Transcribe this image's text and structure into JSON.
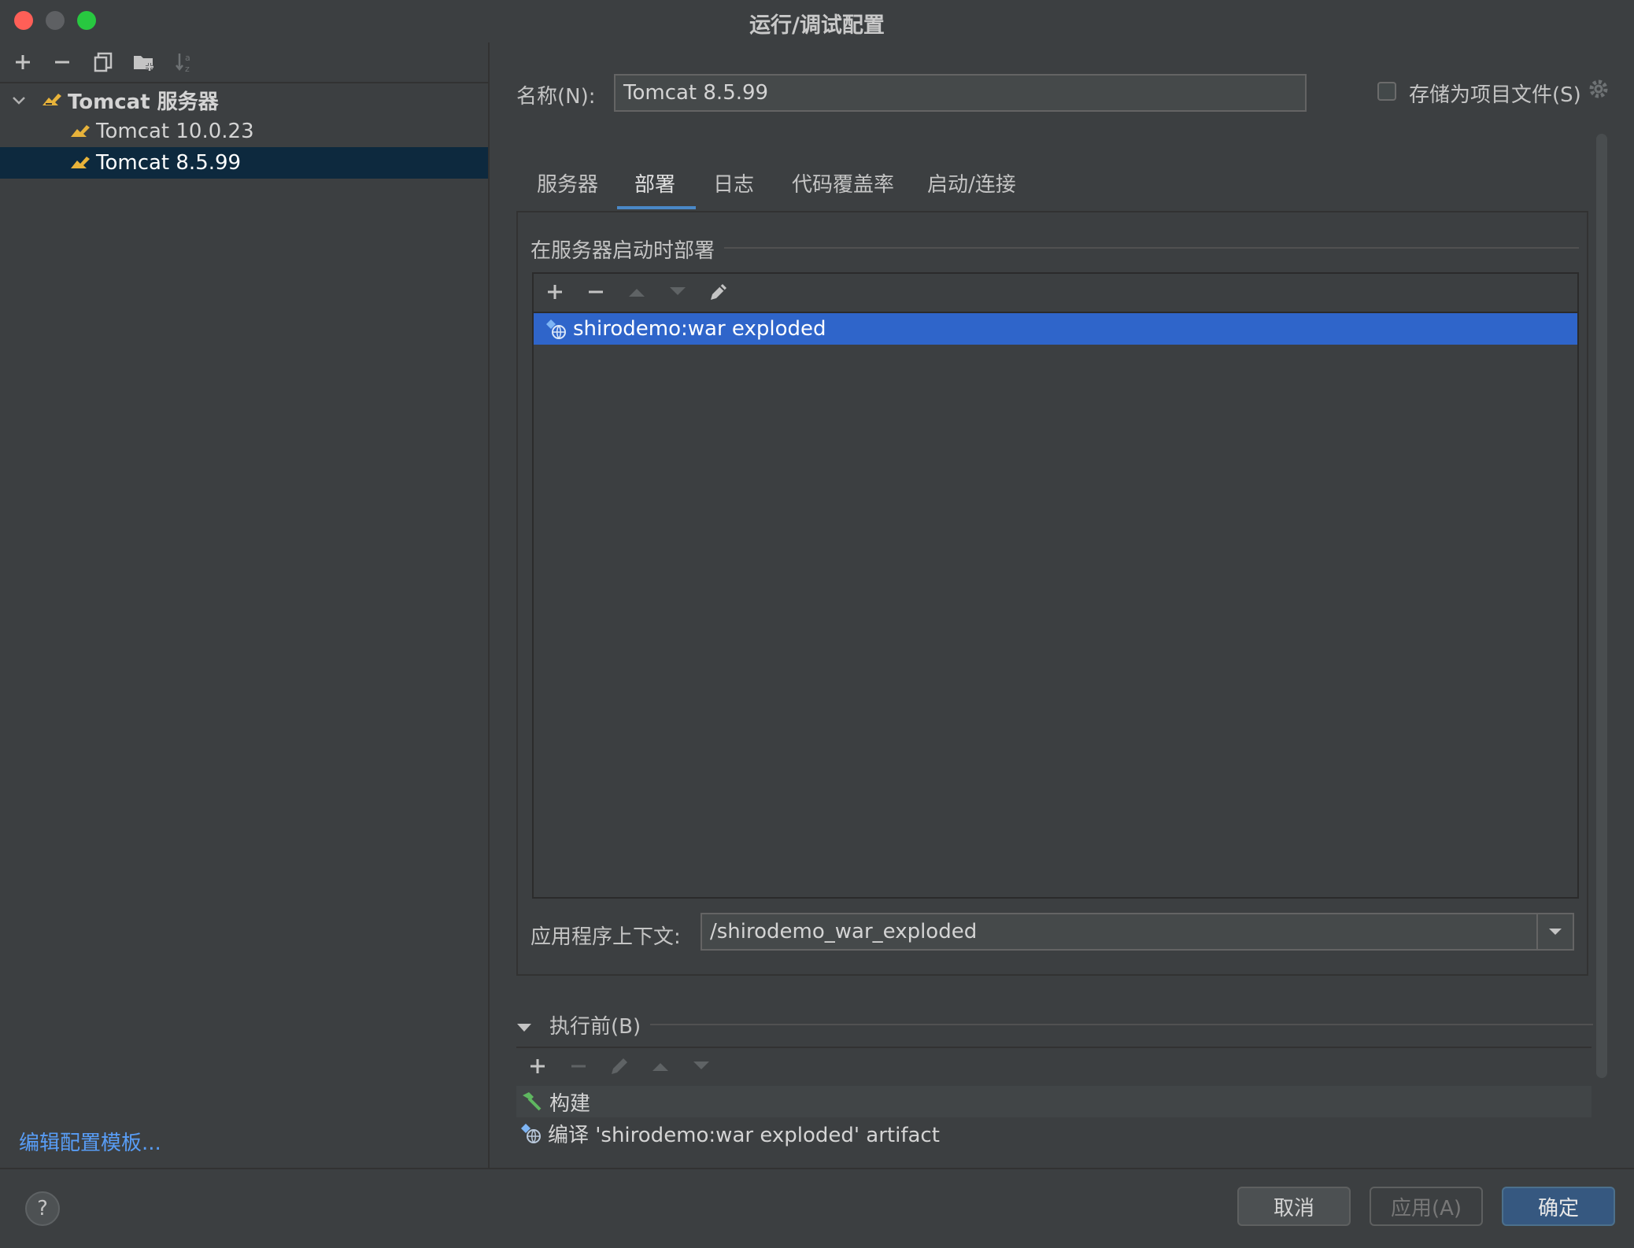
{
  "window": {
    "title": "运行/调试配置"
  },
  "left": {
    "tree": {
      "group_label": "Tomcat 服务器",
      "items": [
        {
          "label": "Tomcat 10.0.23"
        },
        {
          "label": "Tomcat 8.5.99"
        }
      ]
    },
    "edit_templates_link": "编辑配置模板..."
  },
  "right": {
    "name_label": "名称(N):",
    "name_value": "Tomcat 8.5.99",
    "store_as_project_file_label": "存储为项目文件(S)",
    "tabs": [
      "服务器",
      "部署",
      "日志",
      "代码覆盖率",
      "启动/连接"
    ],
    "active_tab": "部署",
    "deploy_section_title": "在服务器启动时部署",
    "deploy_items": [
      {
        "label": "shirodemo:war exploded"
      }
    ],
    "app_context_label": "应用程序上下文:",
    "app_context_value": "/shirodemo_war_exploded",
    "before_launch_title": "执行前(B)",
    "before_launch_items": [
      {
        "label": "构建",
        "icon": "hammer-icon"
      },
      {
        "label": "编译 'shirodemo:war exploded' artifact",
        "icon": "artifact-icon"
      }
    ]
  },
  "buttons": {
    "help": "?",
    "cancel": "取消",
    "apply": "应用(A)",
    "ok": "确定"
  },
  "colors": {
    "background": "#3c3f41",
    "selection_blue": "#2f65ca",
    "tab_underline": "#4a88c7",
    "link": "#589df6",
    "ok_button": "#365880",
    "close": "#ff5f57",
    "zoom": "#28c840"
  }
}
